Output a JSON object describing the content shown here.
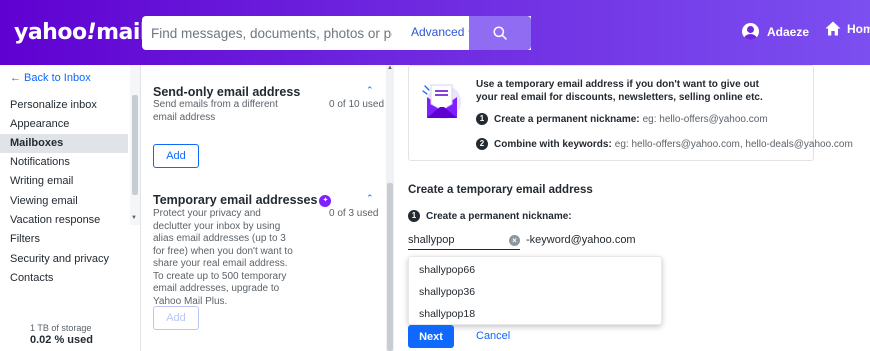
{
  "header": {
    "logo": "yahoo!mail",
    "logo_main": "yahoo",
    "logo_slash": "!",
    "logo_tail": "mail",
    "search_placeholder": "Find messages, documents, photos or people",
    "advanced_label": "Advanced",
    "user_name": "Adaeze",
    "home_label": "Home"
  },
  "sidebar": {
    "back_label": "← Back to Inbox",
    "items": [
      {
        "label": "Personalize inbox"
      },
      {
        "label": "Appearance"
      },
      {
        "label": "Mailboxes",
        "active": true
      },
      {
        "label": "Notifications"
      },
      {
        "label": "Writing email"
      },
      {
        "label": "Viewing email"
      },
      {
        "label": "Vacation response"
      },
      {
        "label": "Filters"
      },
      {
        "label": "Security and privacy"
      },
      {
        "label": "Contacts"
      }
    ],
    "storage_total": "1 TB of storage",
    "storage_used": "0.02 % used"
  },
  "middle": {
    "send_only": {
      "title": "Send-only email address",
      "description": "Send emails from a different email address",
      "count": "0 of 10 used",
      "add_label": "Add"
    },
    "temporary": {
      "title": "Temporary email addresses",
      "description": "Protect your privacy and declutter your inbox by using alias email addresses (up to 3 for free) when you don't want to share your real email address. To create up to 500 temporary email addresses, upgrade to Yahoo Mail Plus.",
      "count": "0 of 3 used",
      "add_label": "Add"
    }
  },
  "info_card": {
    "title": "Use a temporary email address if you don't want to give out your real email for discounts, newsletters, selling online etc.",
    "step1_label": "Create a permanent nickname:",
    "step1_example_prefix": "eg: hello",
    "step1_example_suffix": "-offers@yahoo.com",
    "step2_label": "Combine with keywords:",
    "step2_example": "eg: hello-offers@yahoo.com, hello-deals@yahoo.com"
  },
  "form": {
    "title": "Create a temporary email address",
    "step_label": "Create a permanent nickname:",
    "nickname_value": "shallypop",
    "suffix": "-keyword@yahoo.com",
    "suggestions": [
      "shallypop66",
      "shallypop36",
      "shallypop18"
    ],
    "next_label": "Next",
    "cancel_label": "Cancel"
  },
  "colors": {
    "header_start": "#5f01d1",
    "header_end": "#7b4ff0",
    "accent": "#0f69ff",
    "plus_badge": "#7e1fff"
  }
}
